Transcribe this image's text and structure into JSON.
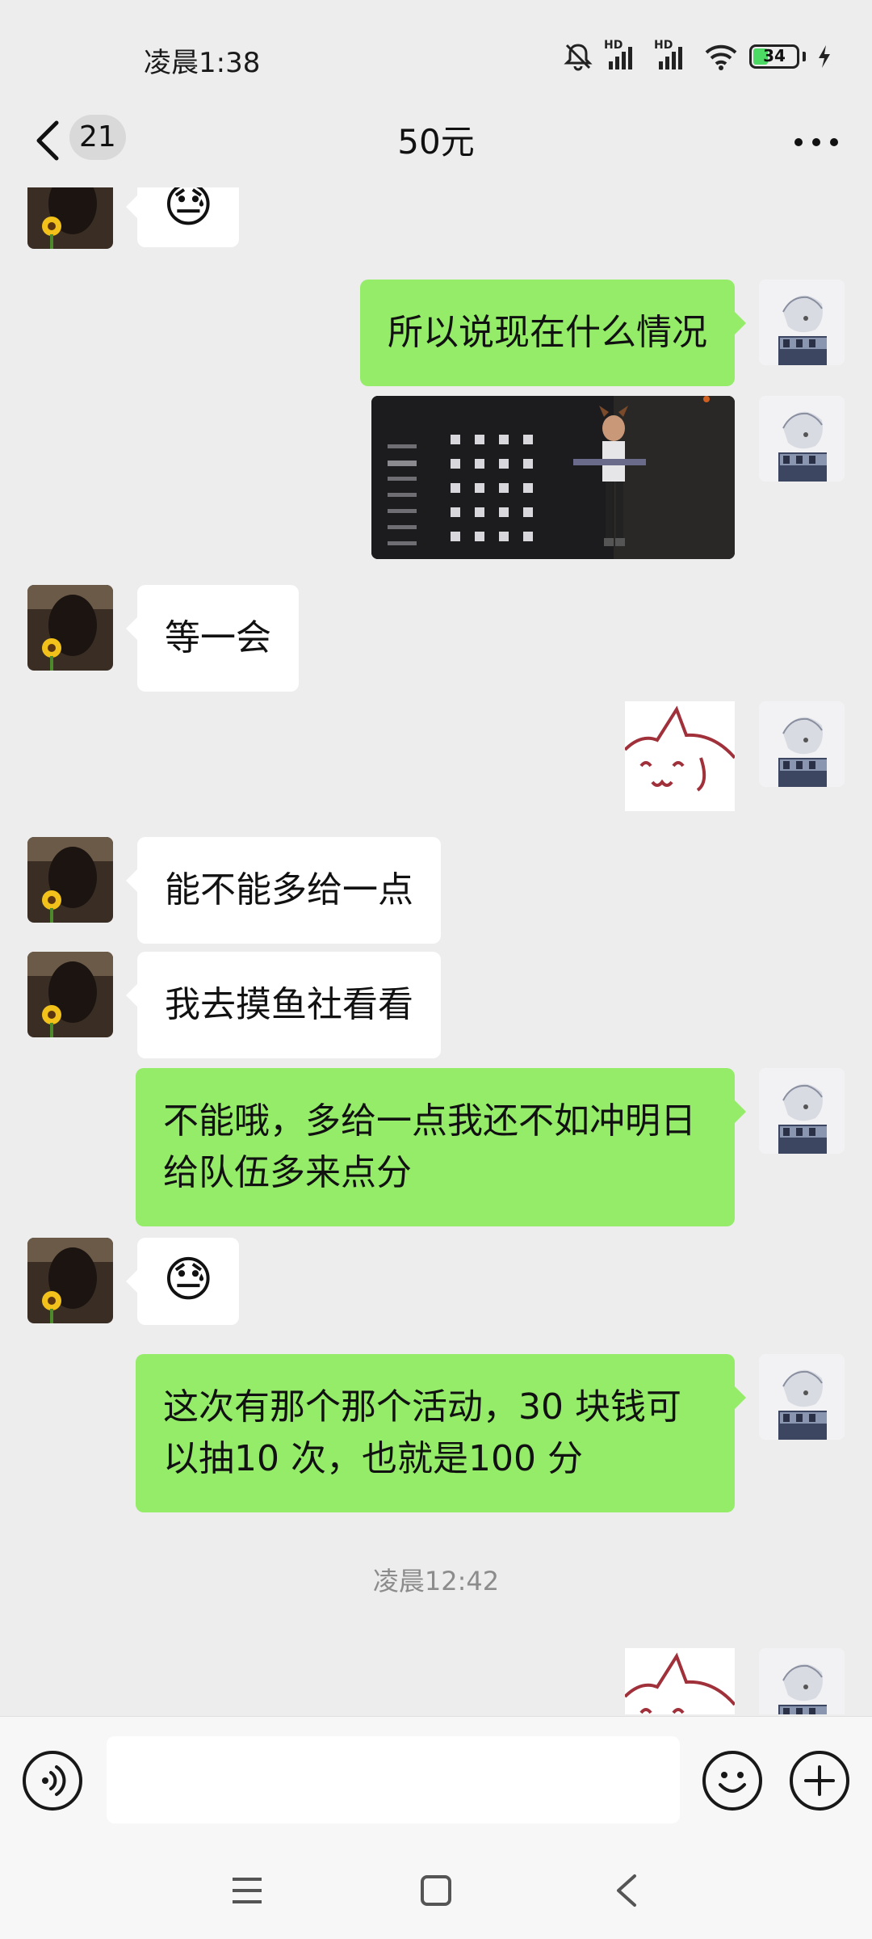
{
  "status_bar": {
    "time": "凌晨1:38",
    "signal_label_1": "HD",
    "signal_label_2": "HD",
    "battery": "34"
  },
  "header": {
    "unread_count": "21",
    "title": "50元"
  },
  "messages": [
    {
      "side": "in",
      "type": "emoji",
      "content": "😓"
    },
    {
      "side": "out",
      "type": "text",
      "content": "所以说现在什么情况"
    },
    {
      "side": "out",
      "type": "image",
      "content": "game-screenshot"
    },
    {
      "side": "in",
      "type": "text",
      "content": "等一会"
    },
    {
      "side": "out",
      "type": "sticker",
      "content": "cat-sticker"
    },
    {
      "side": "in",
      "type": "text",
      "content": "能不能多给一点"
    },
    {
      "side": "in",
      "type": "text",
      "content": "我去摸鱼社看看"
    },
    {
      "side": "out",
      "type": "text",
      "line1": "不能哦，多给一点我还不如冲明日",
      "line2": "给队伍多来点分"
    },
    {
      "side": "in",
      "type": "emoji",
      "content": "😓"
    },
    {
      "side": "out",
      "type": "text",
      "line1": "这次有那个那个活动，30 块钱可",
      "line2": "以抽10 次，也就是100 分"
    },
    {
      "side": "out",
      "type": "sticker",
      "content": "cat-sticker"
    }
  ],
  "time_divider": "凌晨12:42",
  "input": {
    "voice_icon": "voice-icon",
    "emoji_icon": "emoji-icon",
    "plus_icon": "plus-icon",
    "value": ""
  },
  "colors": {
    "background": "#ededed",
    "outgoing_bubble": "#95ec69",
    "incoming_bubble": "#ffffff",
    "battery_fill": "#4cd964"
  }
}
